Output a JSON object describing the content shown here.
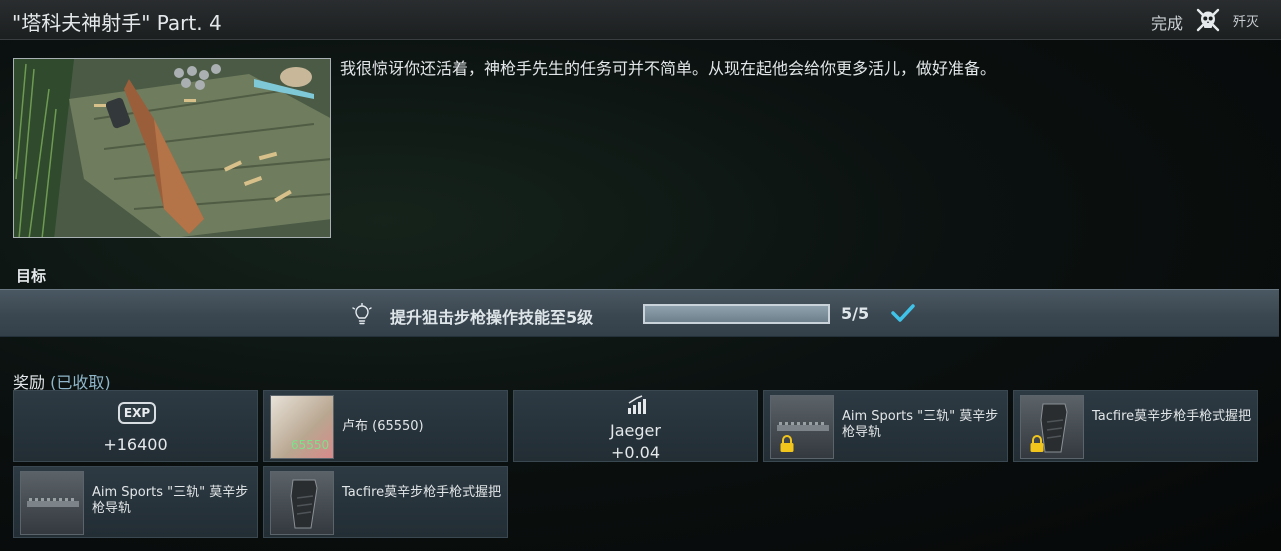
{
  "header": {
    "title": "\"塔科夫神射手\" Part. 4",
    "status": "完成",
    "trader": "歼灭"
  },
  "quest": {
    "description": "我很惊讶你还活着，神枪手先生的任务可并不简单。从现在起他会给你更多活儿，做好准备。",
    "image_icon": "rifle-on-crate"
  },
  "objectives": {
    "label": "目标",
    "items": [
      {
        "text": "提升狙击步枪操作技能至5级",
        "progress_text": "5/5",
        "progress": 1.0,
        "complete_icon": "check-icon"
      }
    ]
  },
  "rewards": {
    "title": "奖励",
    "subtitle": "(已收取)",
    "exp": {
      "badge": "EXP",
      "value": "+16400"
    },
    "money": {
      "name": "卢布 (65550)",
      "amount": "65550"
    },
    "reputation": {
      "trader": "Jaeger",
      "value": "+0.04"
    },
    "items": [
      {
        "name": "Aim Sports \"三轨\" 莫辛步枪导轨",
        "locked": true
      },
      {
        "name": "Tacfire莫辛步枪手枪式握把",
        "locked": true
      },
      {
        "name": "Aim Sports \"三轨\" 莫辛步枪导轨",
        "locked": false
      },
      {
        "name": "Tacfire莫辛步枪手枪式握把",
        "locked": false
      }
    ]
  },
  "colors": {
    "accent_check": "#3fc3e8",
    "money_green": "#7fe08a",
    "objective_bar": "#3b4750"
  }
}
